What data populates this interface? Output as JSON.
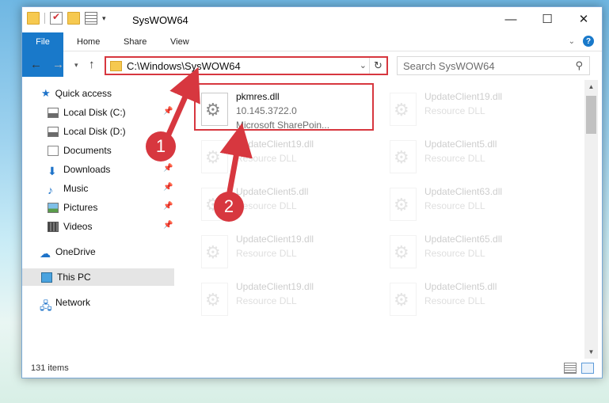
{
  "window": {
    "title": "SysWOW64",
    "controls": {
      "minimize": "—",
      "maximize": "☐",
      "close": "✕"
    }
  },
  "ribbon": {
    "tabs": [
      {
        "label": "File"
      },
      {
        "label": "Home"
      },
      {
        "label": "Share"
      },
      {
        "label": "View"
      }
    ],
    "help": "?"
  },
  "navigation": {
    "path": "C:\\Windows\\SysWOW64",
    "search_placeholder": "Search SysWOW64"
  },
  "sidebar": {
    "items": [
      {
        "label": "Quick access",
        "icon": "star-icon"
      },
      {
        "label": "Local Disk (C:)",
        "icon": "drive-icon",
        "pinned": true
      },
      {
        "label": "Local Disk (D:)",
        "icon": "drive-icon"
      },
      {
        "label": "Documents",
        "icon": "documents-icon",
        "pinned": true
      },
      {
        "label": "Downloads",
        "icon": "downloads-icon",
        "pinned": true
      },
      {
        "label": "Music",
        "icon": "music-icon",
        "pinned": true
      },
      {
        "label": "Pictures",
        "icon": "pictures-icon",
        "pinned": true
      },
      {
        "label": "Videos",
        "icon": "videos-icon",
        "pinned": true
      },
      {
        "label": "OneDrive",
        "icon": "onedrive-icon"
      },
      {
        "label": "This PC",
        "icon": "this-pc-icon",
        "selected": true
      },
      {
        "label": "Network",
        "icon": "network-icon"
      }
    ]
  },
  "files": [
    {
      "name": "pkmres.dll",
      "line2": "10.145.3722.0",
      "line3": "Microsoft SharePoin...",
      "highlighted": true
    },
    {
      "name": "UpdateClient19.dll",
      "line2": "Resource DLL"
    },
    {
      "name": "UpdateClient19.dll",
      "line2": "Resource DLL"
    },
    {
      "name": "UpdateClient5.dll",
      "line2": "Resource DLL"
    },
    {
      "name": "UpdateClient5.dll",
      "line2": "Resource DLL"
    },
    {
      "name": "UpdateClient63.dll",
      "line2": "Resource DLL"
    },
    {
      "name": "UpdateClient19.dll",
      "line2": "Resource DLL"
    },
    {
      "name": "UpdateClient65.dll",
      "line2": "Resource DLL"
    },
    {
      "name": "UpdateClient19.dll",
      "line2": "Resource DLL"
    },
    {
      "name": "UpdateClient5.dll",
      "line2": "Resource DLL"
    }
  ],
  "status": {
    "item_count": "131 items"
  },
  "annotations": {
    "step1": "1",
    "step2": "2"
  },
  "colors": {
    "accent": "#1979ca",
    "highlight": "#d7373f"
  }
}
